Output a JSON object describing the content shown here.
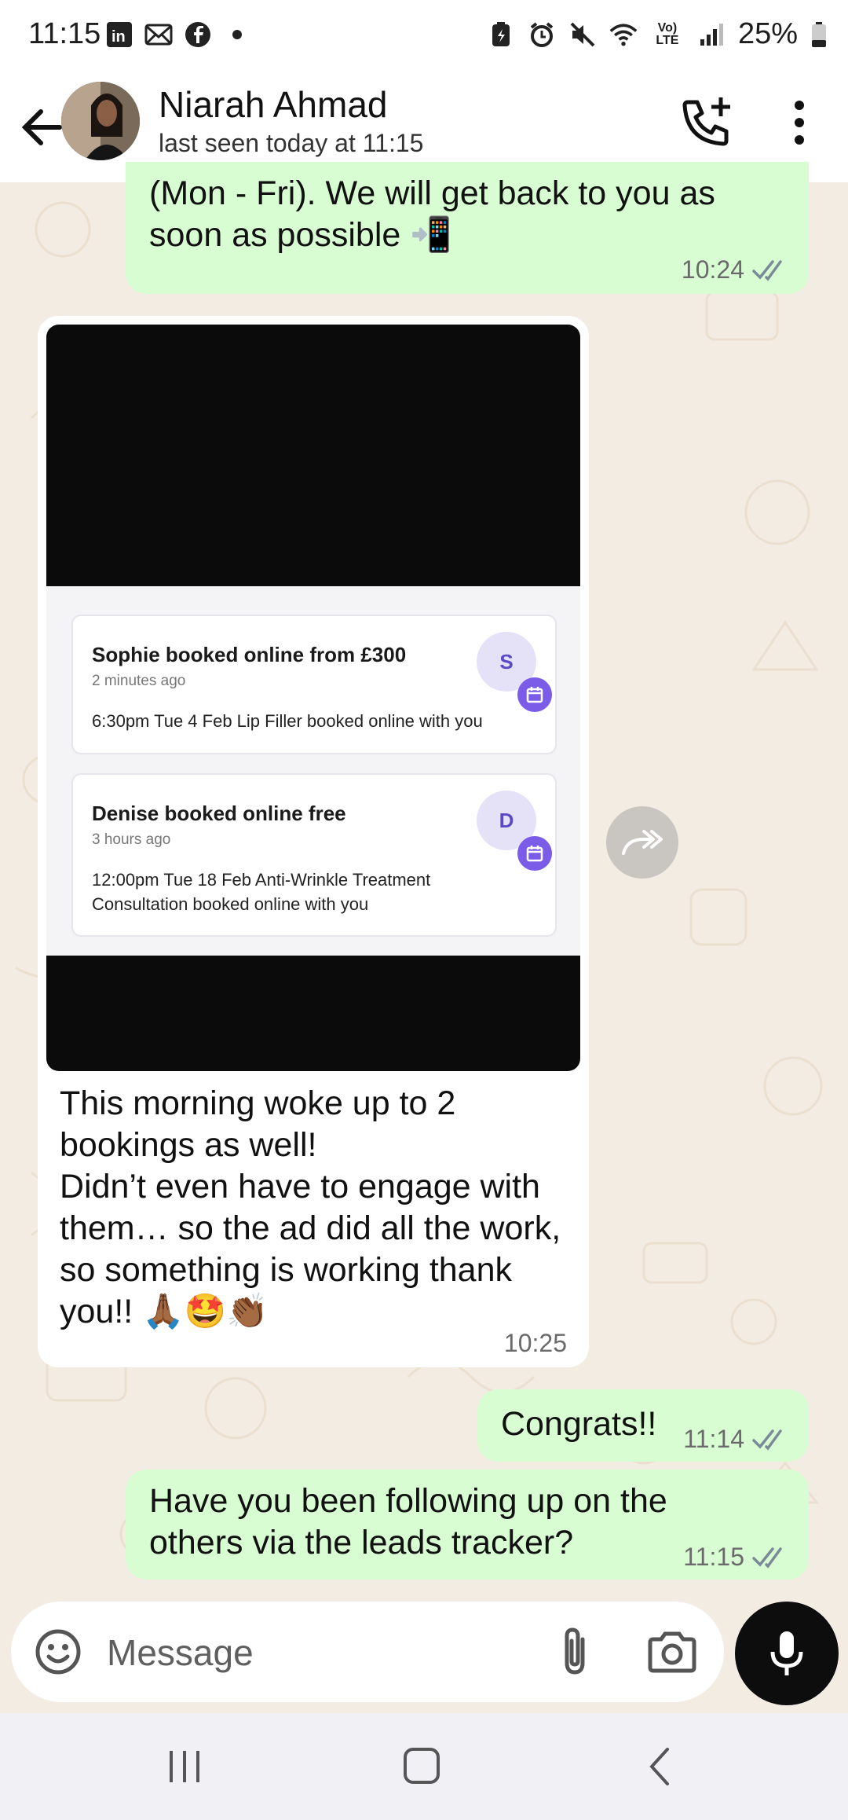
{
  "status_bar": {
    "time": "11:15",
    "left_icons": [
      "linkedin-icon",
      "mail-icon",
      "facebook-icon",
      "dot-icon"
    ],
    "right_icons": [
      "battery-saver-icon",
      "alarm-icon",
      "mute-icon",
      "wifi-icon",
      "volte-icon",
      "signal-icon"
    ],
    "volte_label": "Vo) LTE",
    "battery": "25%"
  },
  "header": {
    "name": "Niarah Ahmad",
    "status": "last seen today at 11:15"
  },
  "messages": [
    {
      "direction": "out",
      "text_line1": "(Mon - Fri). We will get back to you as",
      "text_line2": "soon as possible 📲",
      "time": "10:24",
      "read": true
    },
    {
      "direction": "in",
      "image": {
        "cards": [
          {
            "title": "Sophie booked online from £300",
            "time_ago": "2 minutes ago",
            "detail": "6:30pm Tue 4 Feb Lip Filler booked online with you",
            "initial": "S"
          },
          {
            "title": "Denise booked online free",
            "time_ago": "3 hours ago",
            "detail": "12:00pm Tue 18 Feb Anti-Wrinkle Treatment Consultation booked online with you",
            "initial": "D"
          }
        ]
      },
      "text": "This morning woke up to 2 bookings as well!\nDidn’t even have to engage with them… so the ad did all the work, so something is working thank you!! 🙏🏾🤩👏🏾",
      "time": "10:25"
    },
    {
      "direction": "out",
      "text": "Congrats!!",
      "time": "11:14",
      "read": true
    },
    {
      "direction": "out",
      "text": "Have you been following up on the others via the leads tracker?",
      "time": "11:15",
      "read": true
    }
  ],
  "composer": {
    "placeholder": "Message"
  },
  "colors": {
    "outgoing_bubble": "#d9fdd3",
    "incoming_bubble": "#ffffff",
    "chat_background": "#f3ece2",
    "read_ticks": "#7a8a96",
    "badge_purple": "#7b5ce9"
  }
}
